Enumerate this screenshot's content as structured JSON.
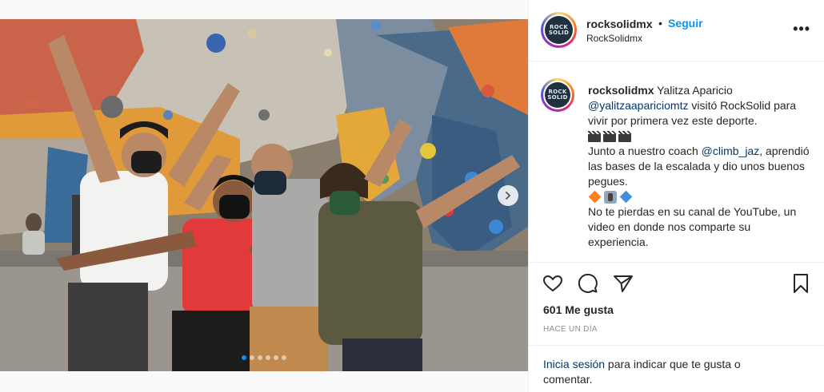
{
  "post": {
    "username": "rocksolidmx",
    "bullet": "•",
    "follow_label": "Seguir",
    "subname": "RockSolidmx",
    "more_label": "•••",
    "avatar_text": [
      "ROCK",
      "SOLID"
    ],
    "carousel": {
      "slide_count": 6,
      "active_index": 0,
      "next_icon": "chevron-right-icon"
    },
    "caption": {
      "author": "rocksolidmx",
      "line1_text": " Yalitza Aparicio ",
      "mention1": "@yalitzaapariciomtz",
      "line1_rest": " visitó RockSolid para vivir por primera vez este deporte.",
      "emoji_row1": [
        "clapper-board-icon",
        "clapper-board-icon",
        "clapper-board-icon"
      ],
      "line2_text": "Junto a nuestro coach ",
      "mention2": "@climb_jaz",
      "line2_rest": ", aprendió las bases de la escalada y dio unos buenos pegues.",
      "emoji_row2": [
        "orange-diamond-icon",
        "climber-icon",
        "blue-diamond-icon"
      ],
      "line3_text": "No te pierdas en su canal de YouTube, un video en donde nos comparte su experiencia."
    },
    "actions": {
      "like_icon": "heart-icon",
      "comment_icon": "comment-icon",
      "share_icon": "send-icon",
      "save_icon": "bookmark-icon"
    },
    "likes": "601 Me gusta",
    "timestamp": "HACE UN DÍA",
    "login_link": "Inicia sesión",
    "login_rest": " para indicar que te gusta o comentar.",
    "colors": {
      "accent": "#0095f6",
      "mention": "#00376b",
      "muted": "#8e8e8e"
    }
  }
}
